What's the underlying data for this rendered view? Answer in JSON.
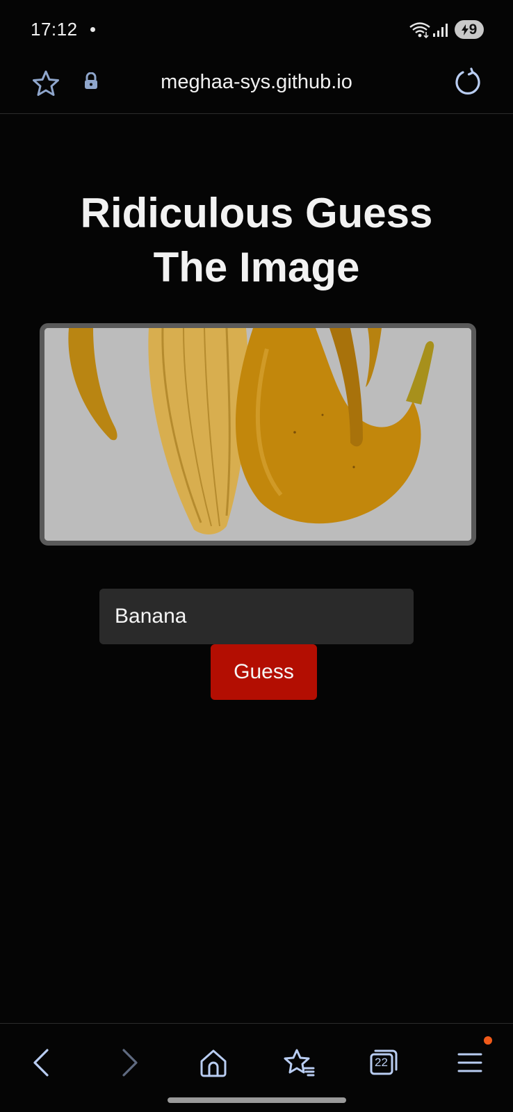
{
  "status_bar": {
    "time": "17:12",
    "battery_level": "9",
    "icons": [
      "wifi-icon",
      "signal-icon",
      "battery-charging-icon"
    ]
  },
  "browser": {
    "url": "meghaa-sys.github.io",
    "icons": [
      "star-icon",
      "lock-icon",
      "reload-icon"
    ]
  },
  "page": {
    "title_line1": "Ridiculous Guess",
    "title_line2": "The Image",
    "guess_input_value": "Banana",
    "guess_button_label": "Guess"
  },
  "bottom_nav": {
    "tabs_count": "22",
    "items": [
      "back-icon",
      "forward-icon",
      "home-icon",
      "bookmarks-icon",
      "tabs-icon",
      "menu-icon"
    ]
  },
  "colors": {
    "background": "#050505",
    "guess_button": "#b30e02",
    "input_background": "#2a2a2a",
    "browser_icon": "#b9cdf2",
    "notification_dot": "#f05a1a"
  }
}
